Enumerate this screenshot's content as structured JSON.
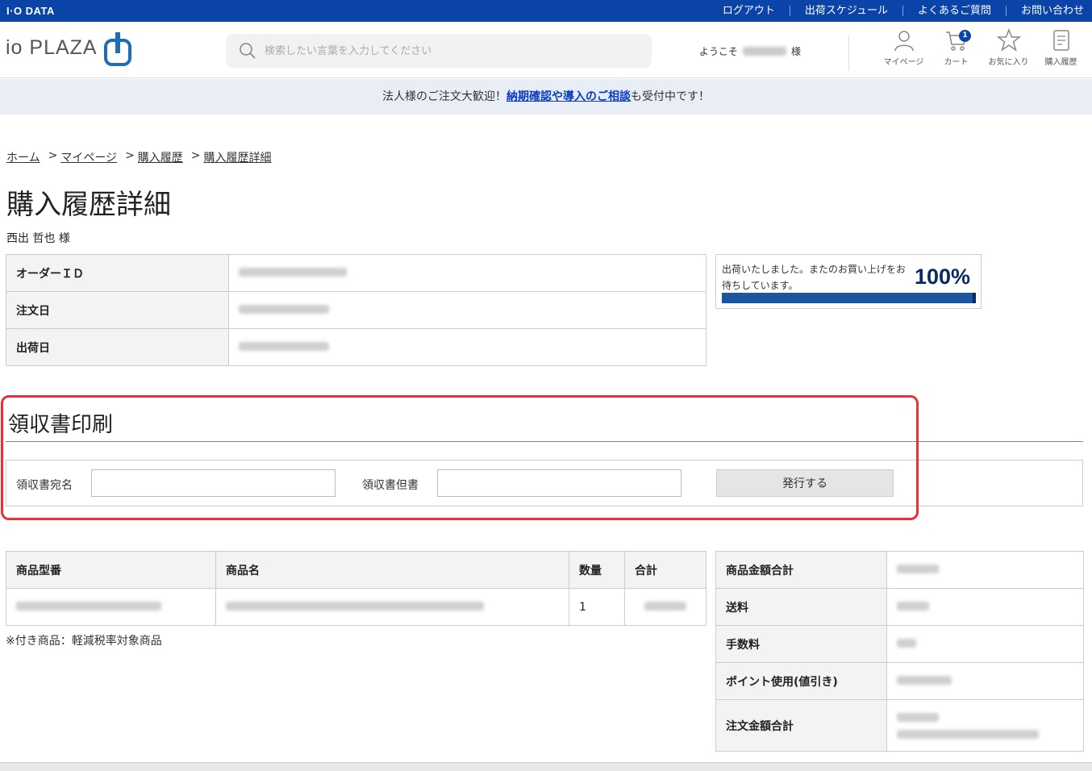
{
  "brand": "I·O DATA",
  "top_links": [
    "ログアウト",
    "出荷スケジュール",
    "よくあるご質問",
    "お問い合わせ"
  ],
  "logo_text": "io PLAZA",
  "search": {
    "placeholder": "検索したい言葉を入力してください"
  },
  "welcome": {
    "prefix": "ようこそ",
    "suffix": "様"
  },
  "header_icons": [
    {
      "label": "マイページ",
      "icon": "user-icon"
    },
    {
      "label": "カート",
      "icon": "cart-icon",
      "badge": "1"
    },
    {
      "label": "お気に入り",
      "icon": "star-icon"
    },
    {
      "label": "購入履歴",
      "icon": "document-icon"
    }
  ],
  "notice": {
    "before": "法人様のご注文大歓迎！",
    "link": "納期確認や導入のご相談",
    "after": "も受付中です！"
  },
  "breadcrumb": [
    "ホーム",
    "マイページ",
    "購入履歴",
    "購入履歴詳細"
  ],
  "page_title": "購入履歴詳細",
  "customer_name": "西出 哲也 様",
  "order_info": [
    {
      "label": "オーダーＩＤ"
    },
    {
      "label": "注文日"
    },
    {
      "label": "出荷日"
    }
  ],
  "status": {
    "message": "出荷いたしました。またのお買い上げをお待ちしています。",
    "percent_text": "100%",
    "progress": 100
  },
  "receipt": {
    "title": "領収書印刷",
    "addressee_label": "領収書宛名",
    "proviso_label": "領収書但書",
    "issue_button": "発行する"
  },
  "items_table": {
    "headers": [
      "商品型番",
      "商品名",
      "数量",
      "合計"
    ],
    "rows": [
      {
        "qty": "1"
      }
    ]
  },
  "tax_note": "※付き商品：軽減税率対象商品",
  "summary": [
    "商品金額合計",
    "送料",
    "手数料",
    "ポイント使用(値引き)",
    "注文金額合計"
  ],
  "colors": {
    "top_bar": "#0a44a8",
    "accent": "#0a44a8",
    "highlight": "#e8313b",
    "progress": "#1c56a0"
  }
}
